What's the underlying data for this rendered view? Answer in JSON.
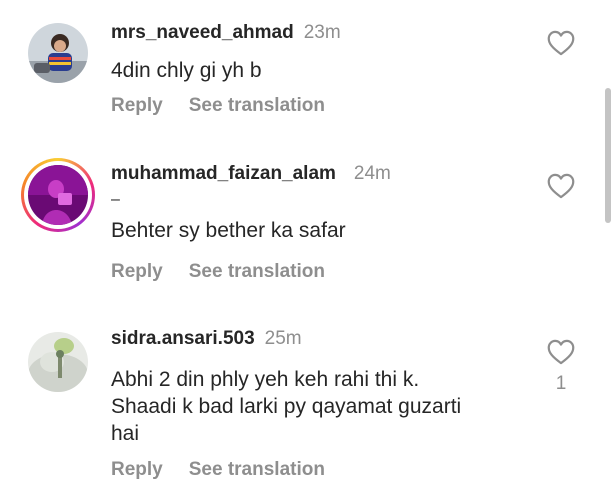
{
  "comments": [
    {
      "username": "mrs_naveed_ahmad",
      "time": "23m",
      "lines": [
        "4din chly gi yh b"
      ],
      "reply_label": "Reply",
      "translate_label": "See translation",
      "avatar_icon": "child-photo-avatar",
      "like_icon": "heart-outline-icon"
    },
    {
      "username": "muhammad_faizan_alam",
      "time": "24m",
      "lines": [
        "–",
        "Behter sy bether ka safar"
      ],
      "reply_label": "Reply",
      "translate_label": "See translation",
      "avatar_icon": "story-ring-avatar",
      "like_icon": "heart-outline-icon"
    },
    {
      "username": "sidra.ansari.503",
      "time": "25m",
      "lines": [
        "Abhi 2 din phly yeh keh rahi thi k.",
        "Shaadi k bad larki py qayamat guzarti",
        "hai"
      ],
      "reply_label": "Reply",
      "translate_label": "See translation",
      "like_count": "1",
      "avatar_icon": "flower-photo-avatar",
      "like_icon": "heart-outline-icon"
    }
  ],
  "colors": {
    "text_primary": "#262626",
    "text_secondary": "#8e8e8e",
    "background": "#ffffff"
  }
}
